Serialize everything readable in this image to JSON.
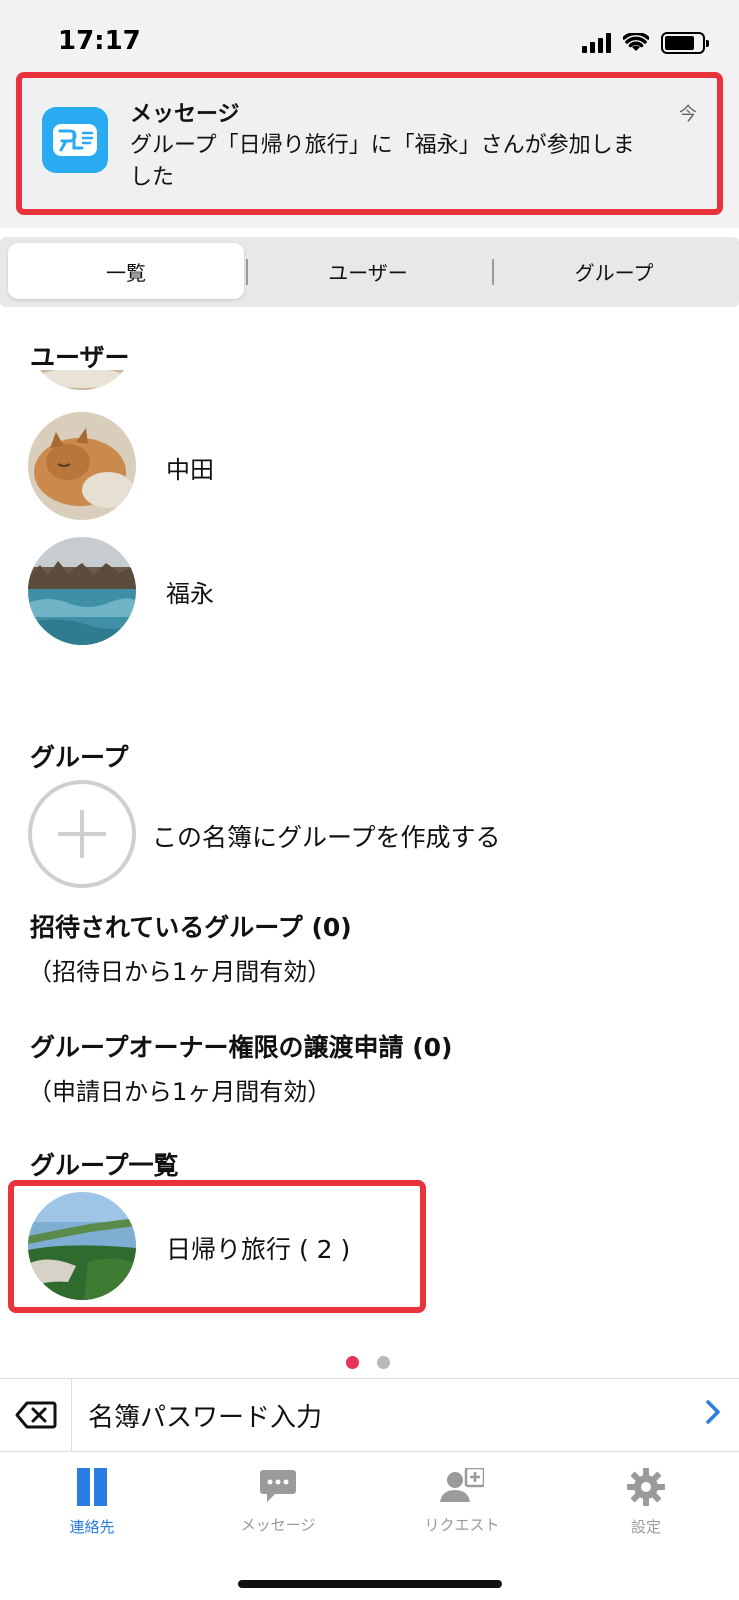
{
  "status_bar": {
    "time": "17:17"
  },
  "notification": {
    "app_name": "メッセージ",
    "body": "グループ「日帰り旅行」に「福永」さんが参加しました",
    "time": "今",
    "icon": "app-logo-icon"
  },
  "segment": {
    "tabs": [
      "一覧",
      "ユーザー",
      "グループ"
    ],
    "active": "一覧"
  },
  "users_section": {
    "title": "ユーザー",
    "users": [
      {
        "name": "中田",
        "avatar": "cat-photo"
      },
      {
        "name": "福永",
        "avatar": "lake-photo"
      }
    ]
  },
  "groups_section": {
    "title": "グループ",
    "create_label": "この名簿にグループを作成する"
  },
  "invited_groups": {
    "title": "招待されているグループ (0)",
    "note": "（招待日から1ヶ月間有効）"
  },
  "owner_transfer": {
    "title": "グループオーナー権限の譲渡申請 (0)",
    "note": "（申請日から1ヶ月間有効）"
  },
  "group_list": {
    "title": "グループ一覧",
    "groups": [
      {
        "name": "日帰り旅行 ( 2 )",
        "avatar": "coast-photo"
      }
    ]
  },
  "pager": {
    "pages": 2,
    "current": 1
  },
  "password_bar": {
    "label": "名簿パスワード入力"
  },
  "tab_bar": {
    "items": [
      {
        "label": "連絡先",
        "icon": "contacts-icon",
        "active": true
      },
      {
        "label": "メッセージ",
        "icon": "chat-bubble-icon",
        "active": false
      },
      {
        "label": "リクエスト",
        "icon": "add-user-icon",
        "active": false
      },
      {
        "label": "設定",
        "icon": "gear-icon",
        "active": false
      }
    ]
  },
  "colors": {
    "accent": "#2a7de1",
    "highlight": "#e8333c",
    "pager_active": "#e8335a"
  }
}
